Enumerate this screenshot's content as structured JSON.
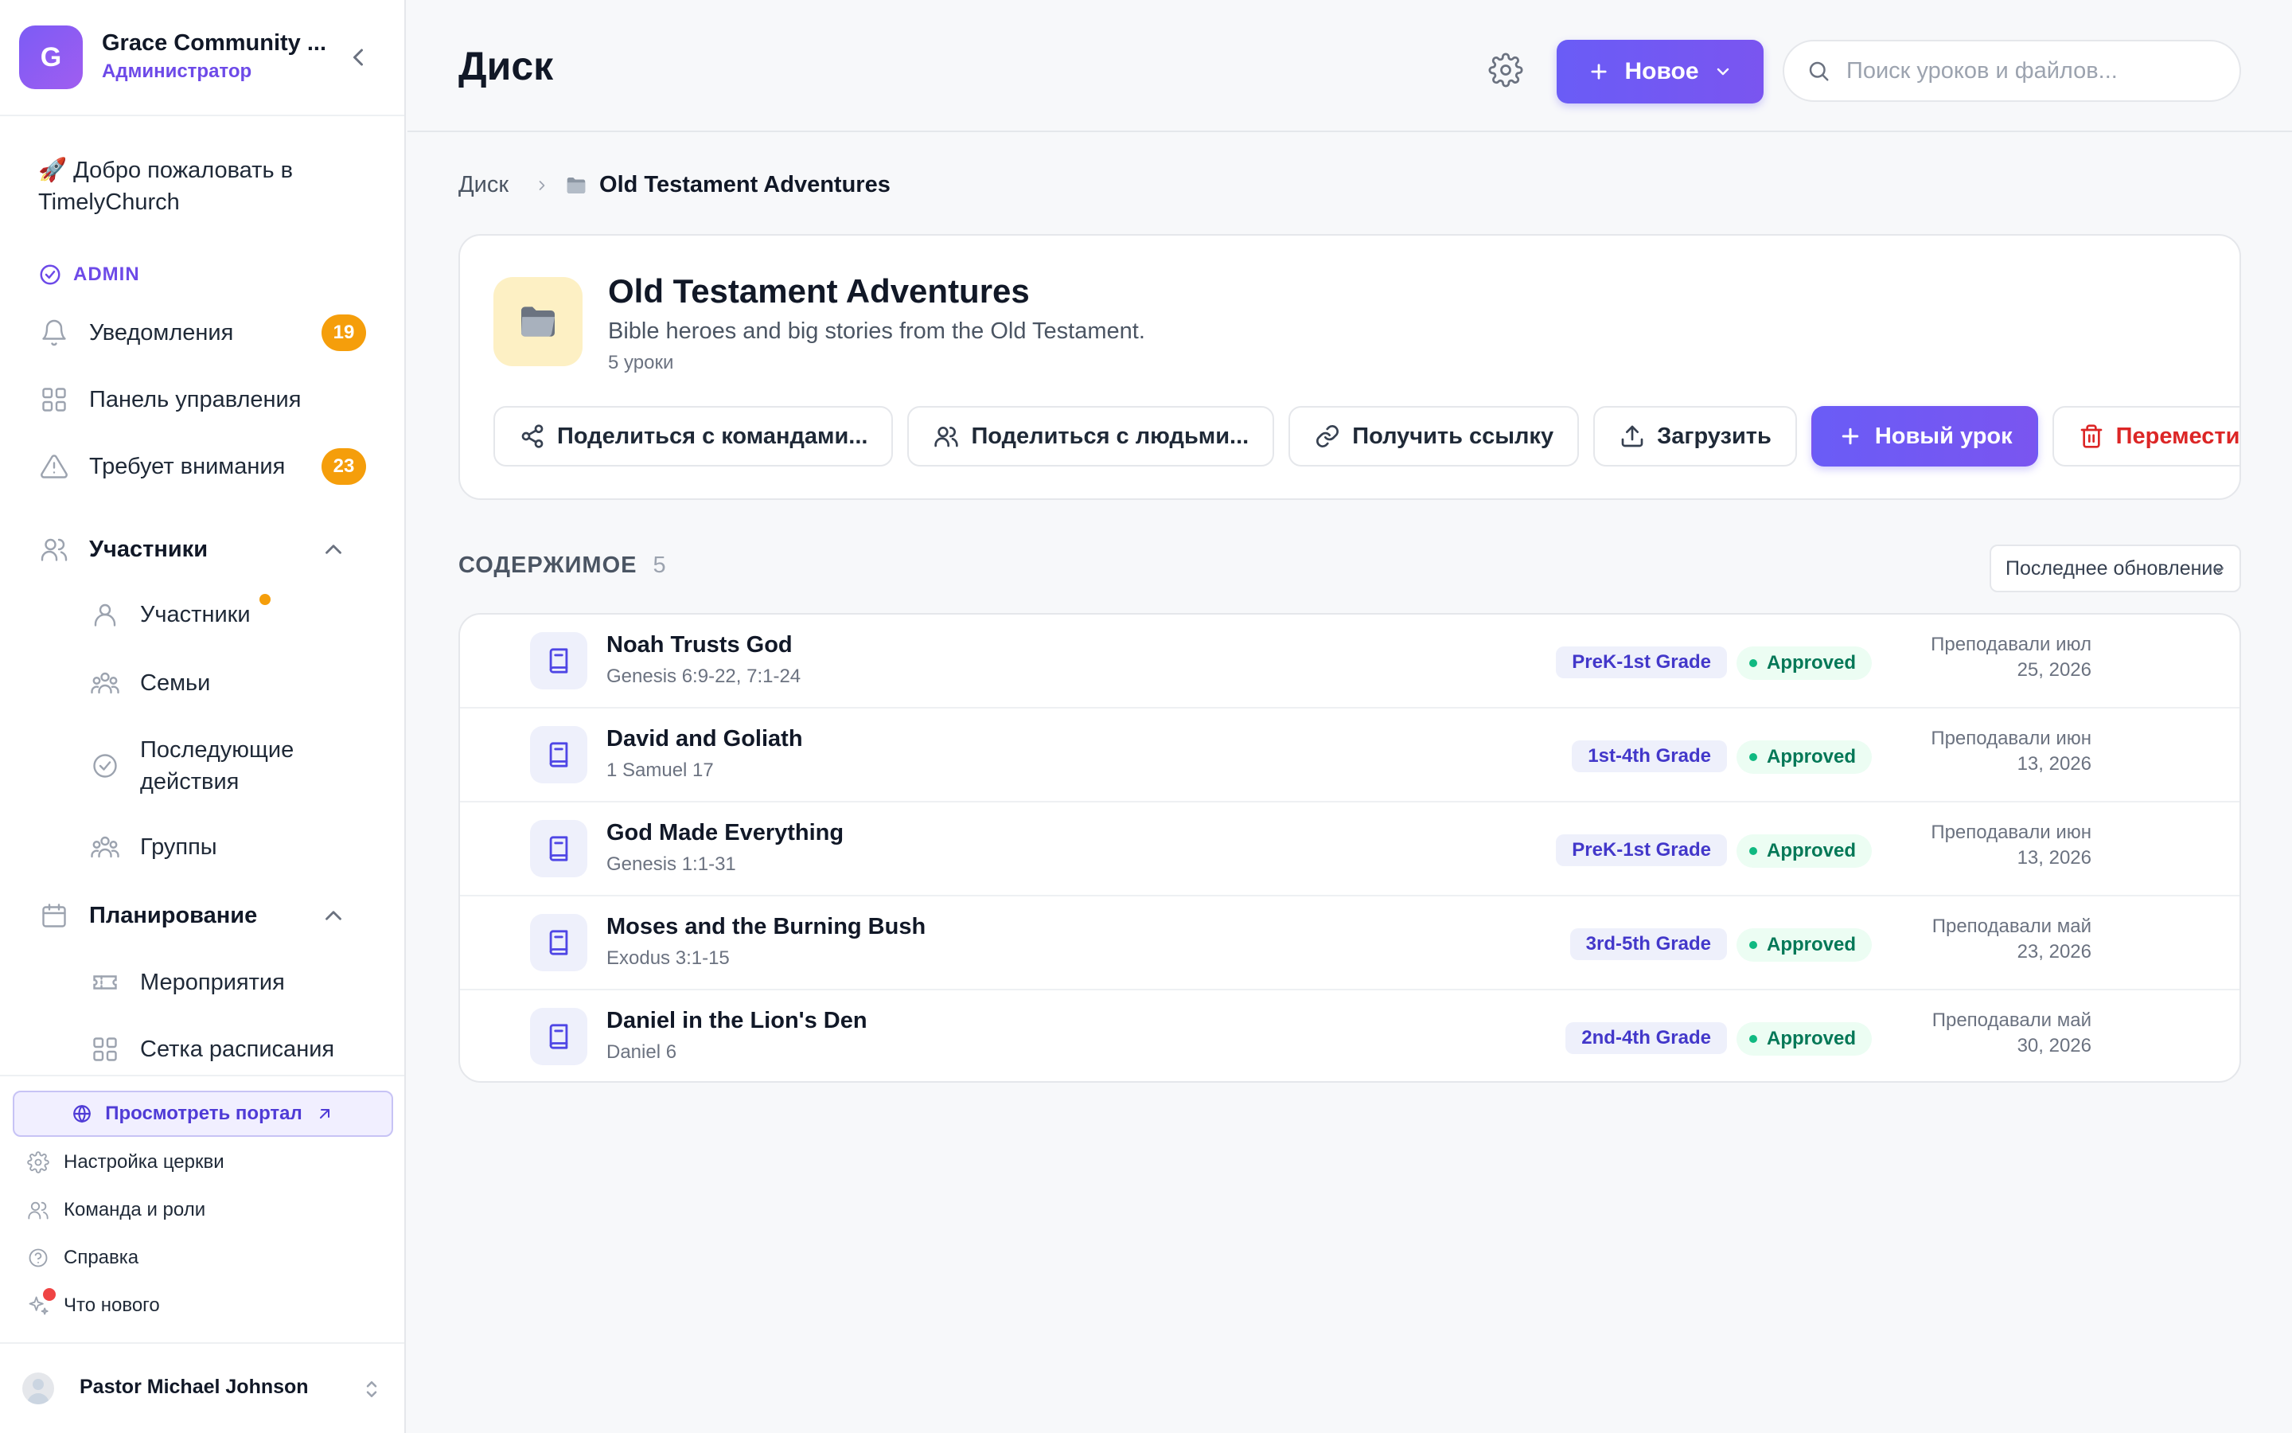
{
  "sidebar": {
    "org_logo_letter": "G",
    "org_name": "Grace Community ...",
    "org_role": "Администратор",
    "welcome": "🚀 Добро пожаловать в TimelyChurch",
    "admin_label": "ADMIN",
    "notifications": {
      "label": "Уведомления",
      "badge": "19"
    },
    "dashboard": {
      "label": "Панель управления"
    },
    "attention": {
      "label": "Требует внимания",
      "badge": "23"
    },
    "members_section": {
      "label": "Участники"
    },
    "members_items": [
      "Участники",
      "Семьи",
      "Последующие действия",
      "Группы"
    ],
    "planning_section": {
      "label": "Планирование"
    },
    "planning_items": [
      "Мероприятия",
      "Сетка расписания"
    ],
    "portal_button": "Просмотреть портал",
    "footer_links": [
      "Настройка церкви",
      "Команда и роли",
      "Справка",
      "Что нового"
    ],
    "user_name": "Pastor Michael Johnson"
  },
  "header": {
    "title": "Диск",
    "new_button": "Новое",
    "search_placeholder": "Поиск уроков и файлов..."
  },
  "breadcrumb": {
    "root": "Диск",
    "current": "Old Testament Adventures"
  },
  "folder": {
    "title": "Old Testament Adventures",
    "description": "Bible heroes and big stories from the Old Testament.",
    "count_label": "5 уроки",
    "actions": {
      "share_teams": "Поделиться с командами...",
      "share_people": "Поделиться с людьми...",
      "get_link": "Получить ссылку",
      "upload": "Загрузить",
      "new_lesson": "Новый урок",
      "trash": "Переместить в корзину"
    }
  },
  "contents": {
    "heading": "СОДЕРЖИМОЕ",
    "count": "5",
    "sort_label": "Последнее обновление",
    "lessons": [
      {
        "title": "Noah Trusts God",
        "scripture": "Genesis 6:9-22, 7:1-24",
        "grade": "PreK-1st Grade",
        "status": "Approved",
        "taught_line1": "Преподавали июл",
        "taught_line2": "25, 2026"
      },
      {
        "title": "David and Goliath",
        "scripture": "1 Samuel 17",
        "grade": "1st-4th Grade",
        "status": "Approved",
        "taught_line1": "Преподавали июн",
        "taught_line2": "13, 2026"
      },
      {
        "title": "God Made Everything",
        "scripture": "Genesis 1:1-31",
        "grade": "PreK-1st Grade",
        "status": "Approved",
        "taught_line1": "Преподавали июн",
        "taught_line2": "13, 2026"
      },
      {
        "title": "Moses and the Burning Bush",
        "scripture": "Exodus 3:1-15",
        "grade": "3rd-5th Grade",
        "status": "Approved",
        "taught_line1": "Преподавали май",
        "taught_line2": "23, 2026"
      },
      {
        "title": "Daniel in the Lion's Den",
        "scripture": "Daniel 6",
        "grade": "2nd-4th Grade",
        "status": "Approved",
        "taught_line1": "Преподавали май",
        "taught_line2": "30, 2026"
      }
    ]
  },
  "colors": {
    "accent": "#6a5cf6",
    "badge_orange": "#f59e0b",
    "approved_green": "#047857",
    "danger_red": "#dc2626"
  }
}
